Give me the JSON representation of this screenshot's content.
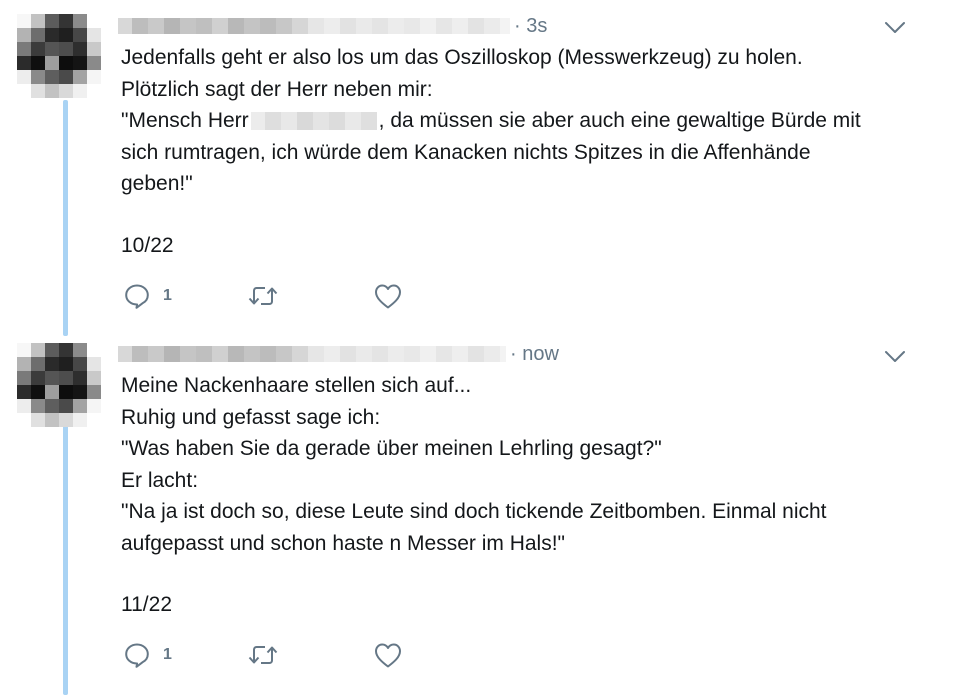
{
  "tweets": [
    {
      "time": "· 3s",
      "lines": [
        "Jedenfalls geht er also los um das Oszilloskop (Messwerkzeug) zu holen.",
        "Plötzlich sagt der Herr neben mir:"
      ],
      "line3_before": "\"Mensch Herr",
      "line3_after": ", da müssen sie aber auch eine gewaltige Bürde mit",
      "line4": "sich rumtragen, ich würde dem Kanacken nichts Spitzes in die Affenhände",
      "line5": "geben!\"",
      "counter": "10/22",
      "reply_count": "1"
    },
    {
      "time": "· now",
      "lines": [
        "Meine Nackenhaare stellen sich auf...",
        "Ruhig und gefasst sage ich:",
        "\"Was haben Sie da gerade über meinen Lehrling gesagt?\"",
        "Er lacht:",
        "\"Na ja ist doch so, diese Leute sind doch tickende Zeitbomben. Einmal nicht",
        "aufgepasst und schon haste n Messer im Hals!\""
      ],
      "counter": "11/22",
      "reply_count": "1"
    }
  ],
  "icons": [
    "reply-icon",
    "retweet-icon",
    "like-icon",
    "chevron-down-icon"
  ],
  "colors": {
    "thread": "#a9d3f4",
    "text": "#14171a",
    "secondary": "#657786"
  }
}
